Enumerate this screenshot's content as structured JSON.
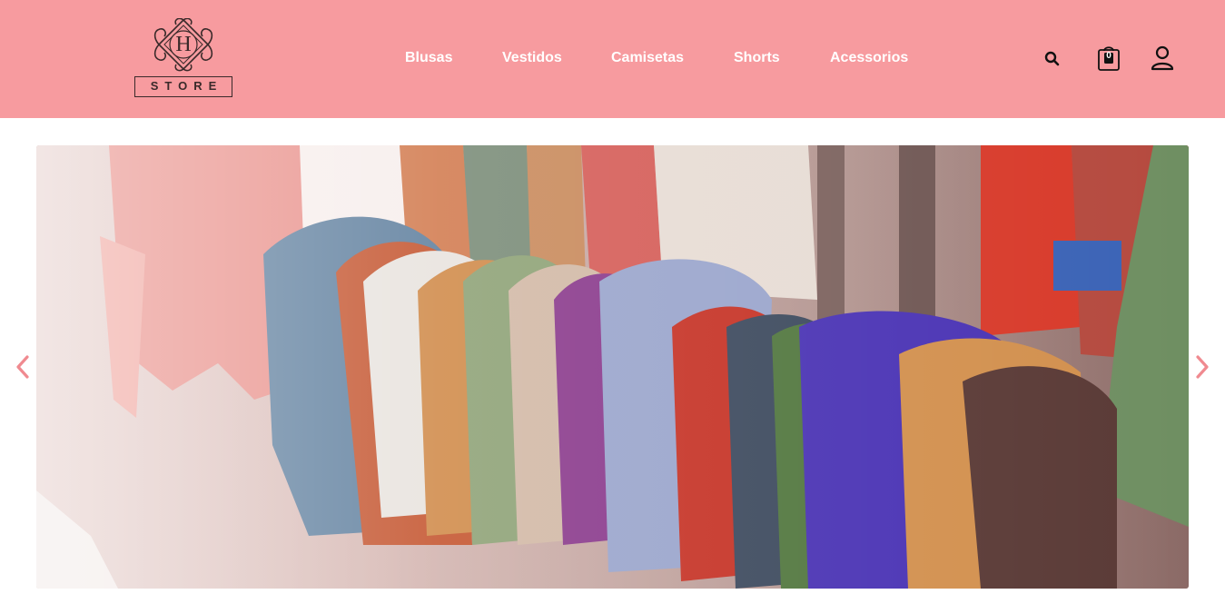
{
  "brand": {
    "logo_letter": "H",
    "logo_text": "STORE"
  },
  "nav": {
    "items": [
      {
        "label": "Blusas"
      },
      {
        "label": "Vestidos"
      },
      {
        "label": "Camisetas"
      },
      {
        "label": "Shorts"
      },
      {
        "label": "Acessorios"
      }
    ]
  },
  "header_icons": {
    "search": "search-icon",
    "cart": "shopping-bag-icon",
    "cart_count": "0",
    "account": "user-icon"
  },
  "slider": {
    "prev_icon": "chevron-left-icon",
    "next_icon": "chevron-right-icon",
    "image_subject": "hanging yarn skeins"
  },
  "colors": {
    "header_bg": "#f79b9f",
    "nav_text": "#ffffff",
    "icon_color": "#111111",
    "arrow_color": "#f08a90"
  }
}
